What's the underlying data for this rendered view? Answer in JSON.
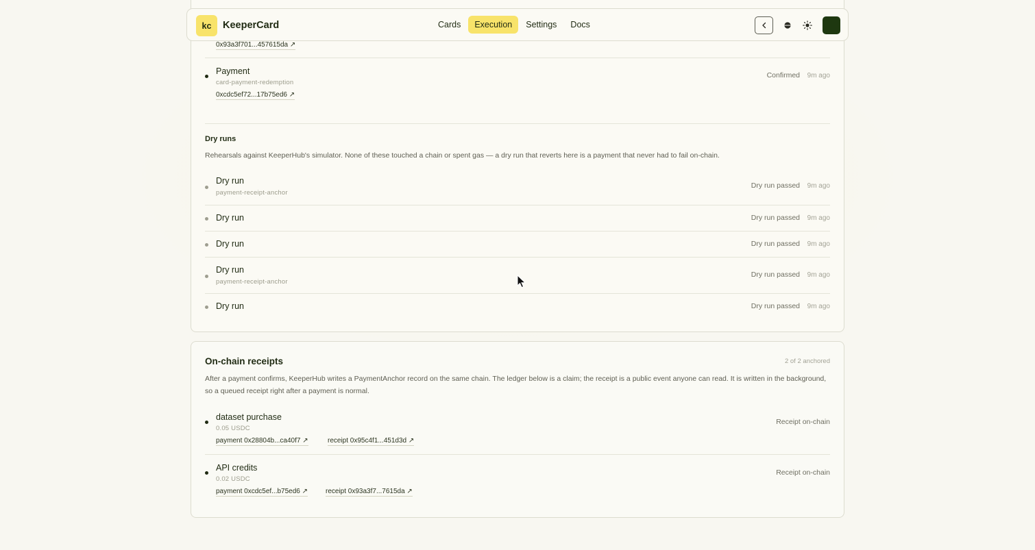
{
  "nav": {
    "logo_initials": "kc",
    "app_name": "KeeperCard",
    "tabs": [
      {
        "label": "Cards",
        "active": false
      },
      {
        "label": "Execution",
        "active": true
      },
      {
        "label": "Settings",
        "active": false
      },
      {
        "label": "Docs",
        "active": false
      }
    ],
    "icons": [
      "chevron-left-icon",
      "moon-icon",
      "sun-icon",
      "avatar"
    ],
    "accent_color": "#f8e36a",
    "avatar_color": "#1e3810"
  },
  "executions": {
    "partial_tx_link": "0x93a3f701...457615da ↗",
    "payment": {
      "title": "Payment",
      "subtitle": "card-payment-redemption",
      "tx_link": "0xcdc5ef72...17b75ed6 ↗",
      "status": "Confirmed",
      "time": "9m ago"
    }
  },
  "dry_runs": {
    "title": "Dry runs",
    "description": "Rehearsals against KeeperHub's simulator. None of these touched a chain or spent gas — a dry run that reverts here is a payment that never had to fail on-chain.",
    "items": [
      {
        "title": "Dry run",
        "subtitle": "payment-receipt-anchor",
        "status": "Dry run passed",
        "time": "9m ago"
      },
      {
        "title": "Dry run",
        "subtitle": "",
        "status": "Dry run passed",
        "time": "9m ago"
      },
      {
        "title": "Dry run",
        "subtitle": "",
        "status": "Dry run passed",
        "time": "9m ago"
      },
      {
        "title": "Dry run",
        "subtitle": "payment-receipt-anchor",
        "status": "Dry run passed",
        "time": "9m ago"
      },
      {
        "title": "Dry run",
        "subtitle": "",
        "status": "Dry run passed",
        "time": "9m ago"
      }
    ]
  },
  "receipts": {
    "title": "On-chain receipts",
    "count": "2 of 2 anchored",
    "description": "After a payment confirms, KeeperHub writes a PaymentAnchor record on the same chain. The ledger below is a claim; the receipt is a public event anyone can read. It is written in the background, so a queued receipt right after a payment is normal.",
    "items": [
      {
        "title": "dataset purchase",
        "amount": "0.05 USDC",
        "payment_link": "payment 0x28804b...ca40f7 ↗",
        "receipt_link": "receipt 0x95c4f1...451d3d ↗",
        "status": "Receipt on-chain"
      },
      {
        "title": "API credits",
        "amount": "0.02 USDC",
        "payment_link": "payment 0xcdc5ef...b75ed6 ↗",
        "receipt_link": "receipt 0x93a3f7...7615da ↗",
        "status": "Receipt on-chain"
      }
    ]
  }
}
